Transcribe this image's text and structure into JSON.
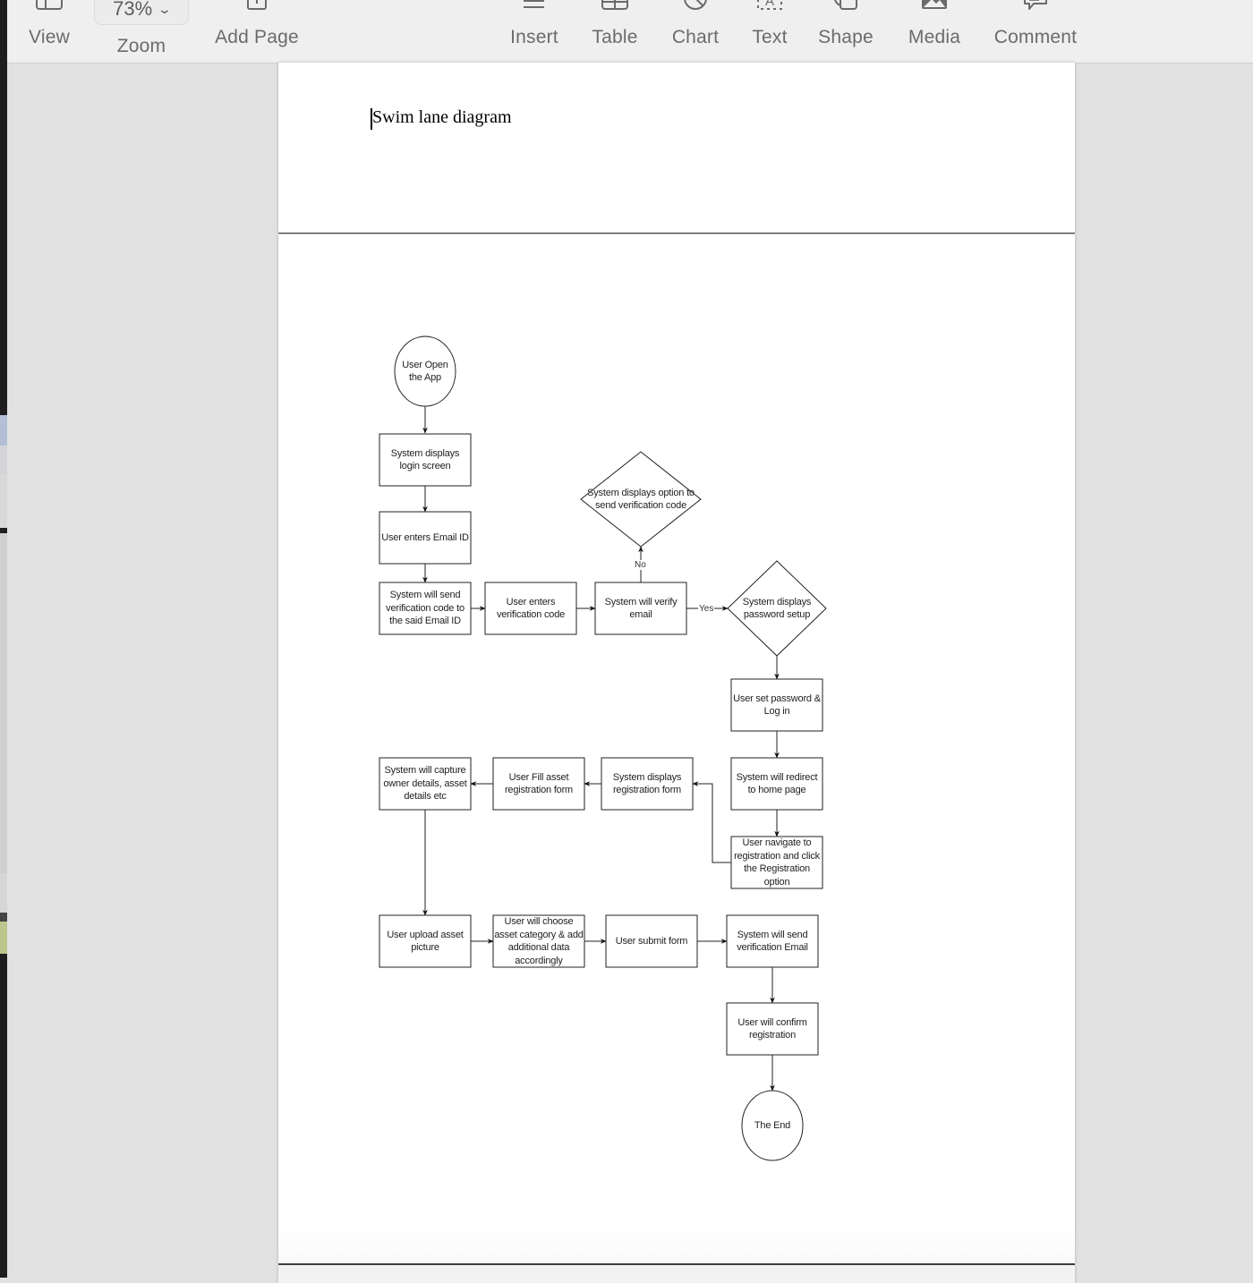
{
  "toolbar": {
    "items": [
      {
        "label": "View",
        "icon": "sidebar-view-icon"
      },
      {
        "label": "Zoom",
        "icon": "zoom-dropdown",
        "value": "73%"
      },
      {
        "label": "Add Page",
        "icon": "add-page-icon"
      },
      {
        "label": "Insert",
        "icon": "insert-icon"
      },
      {
        "label": "Table",
        "icon": "table-icon"
      },
      {
        "label": "Chart",
        "icon": "chart-icon"
      },
      {
        "label": "Text",
        "icon": "text-box-icon"
      },
      {
        "label": "Shape",
        "icon": "shape-icon"
      },
      {
        "label": "Media",
        "icon": "media-icon"
      },
      {
        "label": "Comment",
        "icon": "comment-icon"
      }
    ],
    "zoom_value": "73%"
  },
  "document": {
    "title_text": "Swim lane diagram"
  },
  "diagram": {
    "nodes": [
      {
        "id": "start",
        "shape": "ellipse",
        "text": "User Open the App"
      },
      {
        "id": "login",
        "shape": "rect",
        "text": "System displays login screen"
      },
      {
        "id": "email",
        "shape": "rect",
        "text": "User enters Email ID"
      },
      {
        "id": "sendcode",
        "shape": "rect",
        "text": "System will send verification code to the said Email ID"
      },
      {
        "id": "entercode",
        "shape": "rect",
        "text": "User enters verification code"
      },
      {
        "id": "verify",
        "shape": "rect",
        "text": "System will verify email"
      },
      {
        "id": "resend",
        "shape": "diamond",
        "text": "System displays option to send verification code"
      },
      {
        "id": "pwsetup",
        "shape": "diamond",
        "text": "System displays password setup"
      },
      {
        "id": "setpw",
        "shape": "rect",
        "text": "User set password & Log in"
      },
      {
        "id": "home",
        "shape": "rect",
        "text": "System will redirect to home page"
      },
      {
        "id": "navreg",
        "shape": "rect",
        "text": "User navigate to registration and click the Registration option"
      },
      {
        "id": "regform",
        "shape": "rect",
        "text": "System displays registration form"
      },
      {
        "id": "fillform",
        "shape": "rect",
        "text": "User Fill asset registration form"
      },
      {
        "id": "capture",
        "shape": "rect",
        "text": "System will capture owner details, asset details etc"
      },
      {
        "id": "upload",
        "shape": "rect",
        "text": "User upload asset picture"
      },
      {
        "id": "category",
        "shape": "rect",
        "text": "User will choose asset category & add additional data accordingly"
      },
      {
        "id": "submit",
        "shape": "rect",
        "text": "User submit form"
      },
      {
        "id": "sendemail",
        "shape": "rect",
        "text": "System will send verification Email"
      },
      {
        "id": "confirm",
        "shape": "rect",
        "text": "User will confirm registration"
      },
      {
        "id": "end",
        "shape": "ellipse",
        "text": "The End"
      }
    ],
    "edges": [
      {
        "from": "start",
        "to": "login",
        "label": ""
      },
      {
        "from": "login",
        "to": "email",
        "label": ""
      },
      {
        "from": "email",
        "to": "sendcode",
        "label": ""
      },
      {
        "from": "sendcode",
        "to": "entercode",
        "label": ""
      },
      {
        "from": "entercode",
        "to": "verify",
        "label": ""
      },
      {
        "from": "verify",
        "to": "resend",
        "label": "No"
      },
      {
        "from": "verify",
        "to": "pwsetup",
        "label": "Yes"
      },
      {
        "from": "pwsetup",
        "to": "setpw",
        "label": ""
      },
      {
        "from": "setpw",
        "to": "home",
        "label": ""
      },
      {
        "from": "home",
        "to": "navreg",
        "label": ""
      },
      {
        "from": "navreg",
        "to": "regform",
        "label": ""
      },
      {
        "from": "regform",
        "to": "fillform",
        "label": ""
      },
      {
        "from": "fillform",
        "to": "capture",
        "label": ""
      },
      {
        "from": "capture",
        "to": "upload",
        "label": ""
      },
      {
        "from": "upload",
        "to": "category",
        "label": ""
      },
      {
        "from": "category",
        "to": "submit",
        "label": ""
      },
      {
        "from": "submit",
        "to": "sendemail",
        "label": ""
      },
      {
        "from": "sendemail",
        "to": "confirm",
        "label": ""
      },
      {
        "from": "confirm",
        "to": "end",
        "label": ""
      }
    ]
  }
}
